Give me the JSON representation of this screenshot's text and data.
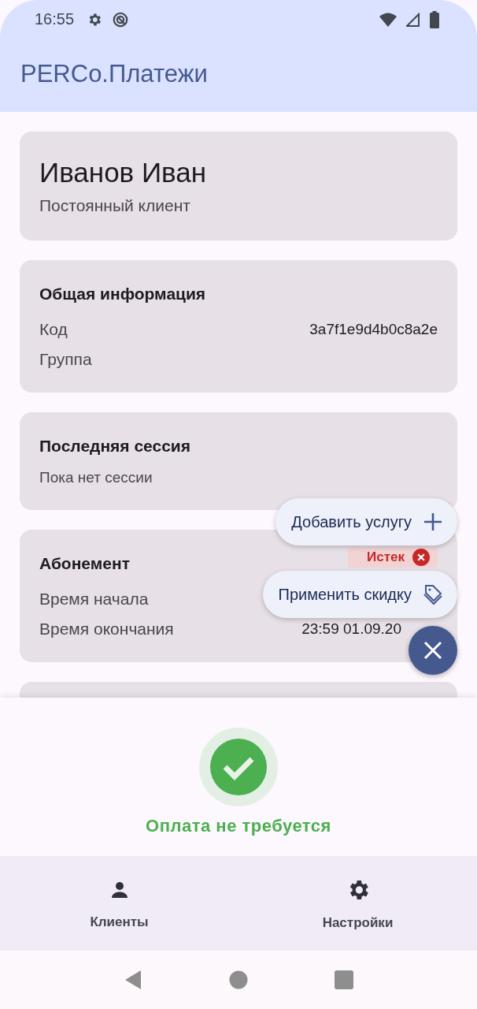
{
  "status_bar": {
    "time": "16:55"
  },
  "app_bar": {
    "title": "PERCo.Платежи"
  },
  "client": {
    "name": "Иванов Иван",
    "category": "Постоянный клиент"
  },
  "sections": [
    {
      "title": "Общая информация",
      "rows": [
        {
          "label": "Код",
          "value": "3a7f1e9d4b0c8a2e"
        },
        {
          "label": "Группа"
        }
      ]
    },
    {
      "title": "Последняя сессия",
      "note": "Пока нет сессии"
    },
    {
      "title": "Абонемент",
      "badge": {
        "text": "Истек",
        "kind": "error"
      },
      "rows": [
        {
          "label": "Время начала"
        },
        {
          "label": "Время окончания",
          "value": "23:59 01.09.20"
        }
      ]
    }
  ],
  "speed_dial": {
    "expanded": true,
    "actions": [
      {
        "label": "Добавить услугу"
      },
      {
        "label": "Применить скидку"
      }
    ]
  },
  "payment_status": {
    "kind": "ok",
    "text": "Оплата не требуется"
  },
  "bottom_nav": [
    {
      "label": "Клиенты",
      "selected": false
    },
    {
      "label": "Настройки",
      "selected": false
    }
  ]
}
